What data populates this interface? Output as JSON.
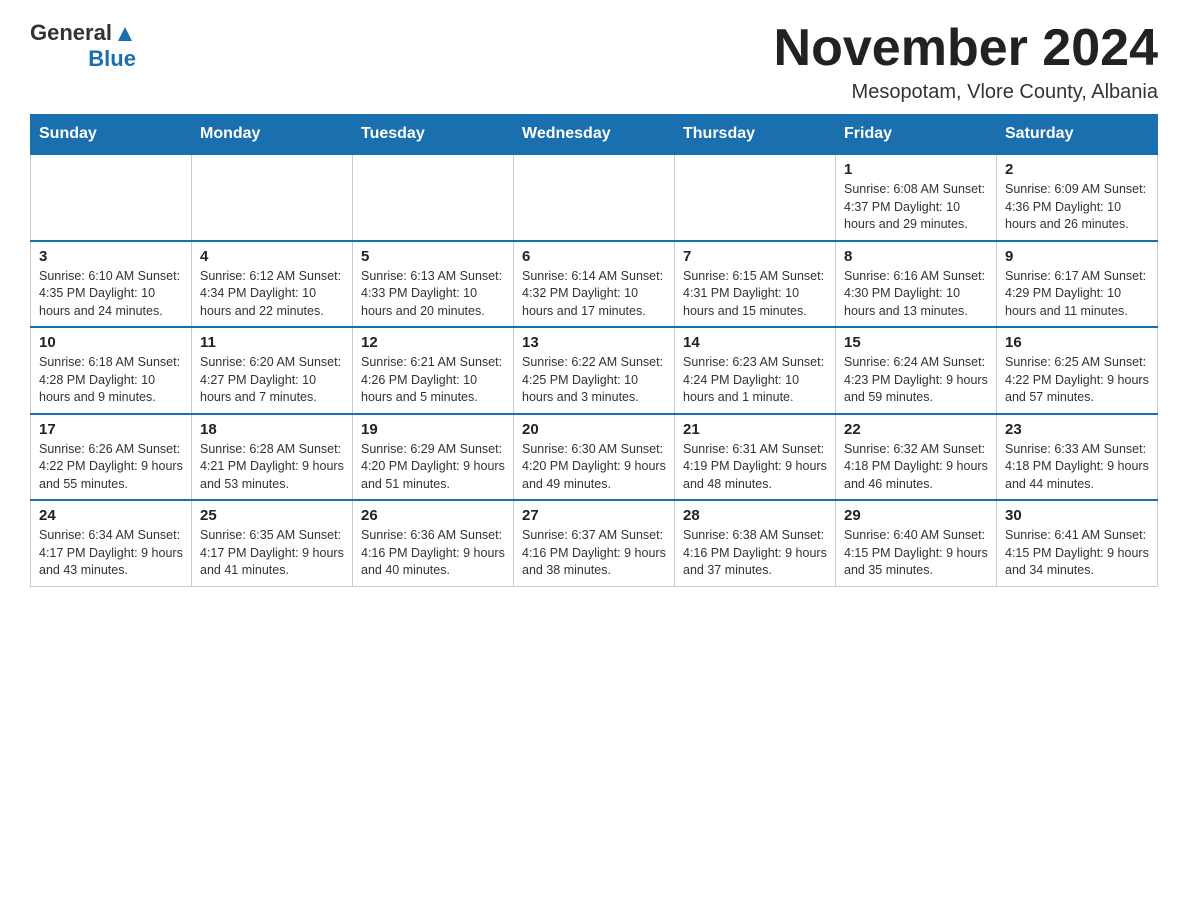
{
  "logo": {
    "general": "General",
    "blue": "Blue"
  },
  "title": "November 2024",
  "subtitle": "Mesopotam, Vlore County, Albania",
  "days_of_week": [
    "Sunday",
    "Monday",
    "Tuesday",
    "Wednesday",
    "Thursday",
    "Friday",
    "Saturday"
  ],
  "weeks": [
    [
      {
        "day": "",
        "info": ""
      },
      {
        "day": "",
        "info": ""
      },
      {
        "day": "",
        "info": ""
      },
      {
        "day": "",
        "info": ""
      },
      {
        "day": "",
        "info": ""
      },
      {
        "day": "1",
        "info": "Sunrise: 6:08 AM\nSunset: 4:37 PM\nDaylight: 10 hours and 29 minutes."
      },
      {
        "day": "2",
        "info": "Sunrise: 6:09 AM\nSunset: 4:36 PM\nDaylight: 10 hours and 26 minutes."
      }
    ],
    [
      {
        "day": "3",
        "info": "Sunrise: 6:10 AM\nSunset: 4:35 PM\nDaylight: 10 hours and 24 minutes."
      },
      {
        "day": "4",
        "info": "Sunrise: 6:12 AM\nSunset: 4:34 PM\nDaylight: 10 hours and 22 minutes."
      },
      {
        "day": "5",
        "info": "Sunrise: 6:13 AM\nSunset: 4:33 PM\nDaylight: 10 hours and 20 minutes."
      },
      {
        "day": "6",
        "info": "Sunrise: 6:14 AM\nSunset: 4:32 PM\nDaylight: 10 hours and 17 minutes."
      },
      {
        "day": "7",
        "info": "Sunrise: 6:15 AM\nSunset: 4:31 PM\nDaylight: 10 hours and 15 minutes."
      },
      {
        "day": "8",
        "info": "Sunrise: 6:16 AM\nSunset: 4:30 PM\nDaylight: 10 hours and 13 minutes."
      },
      {
        "day": "9",
        "info": "Sunrise: 6:17 AM\nSunset: 4:29 PM\nDaylight: 10 hours and 11 minutes."
      }
    ],
    [
      {
        "day": "10",
        "info": "Sunrise: 6:18 AM\nSunset: 4:28 PM\nDaylight: 10 hours and 9 minutes."
      },
      {
        "day": "11",
        "info": "Sunrise: 6:20 AM\nSunset: 4:27 PM\nDaylight: 10 hours and 7 minutes."
      },
      {
        "day": "12",
        "info": "Sunrise: 6:21 AM\nSunset: 4:26 PM\nDaylight: 10 hours and 5 minutes."
      },
      {
        "day": "13",
        "info": "Sunrise: 6:22 AM\nSunset: 4:25 PM\nDaylight: 10 hours and 3 minutes."
      },
      {
        "day": "14",
        "info": "Sunrise: 6:23 AM\nSunset: 4:24 PM\nDaylight: 10 hours and 1 minute."
      },
      {
        "day": "15",
        "info": "Sunrise: 6:24 AM\nSunset: 4:23 PM\nDaylight: 9 hours and 59 minutes."
      },
      {
        "day": "16",
        "info": "Sunrise: 6:25 AM\nSunset: 4:22 PM\nDaylight: 9 hours and 57 minutes."
      }
    ],
    [
      {
        "day": "17",
        "info": "Sunrise: 6:26 AM\nSunset: 4:22 PM\nDaylight: 9 hours and 55 minutes."
      },
      {
        "day": "18",
        "info": "Sunrise: 6:28 AM\nSunset: 4:21 PM\nDaylight: 9 hours and 53 minutes."
      },
      {
        "day": "19",
        "info": "Sunrise: 6:29 AM\nSunset: 4:20 PM\nDaylight: 9 hours and 51 minutes."
      },
      {
        "day": "20",
        "info": "Sunrise: 6:30 AM\nSunset: 4:20 PM\nDaylight: 9 hours and 49 minutes."
      },
      {
        "day": "21",
        "info": "Sunrise: 6:31 AM\nSunset: 4:19 PM\nDaylight: 9 hours and 48 minutes."
      },
      {
        "day": "22",
        "info": "Sunrise: 6:32 AM\nSunset: 4:18 PM\nDaylight: 9 hours and 46 minutes."
      },
      {
        "day": "23",
        "info": "Sunrise: 6:33 AM\nSunset: 4:18 PM\nDaylight: 9 hours and 44 minutes."
      }
    ],
    [
      {
        "day": "24",
        "info": "Sunrise: 6:34 AM\nSunset: 4:17 PM\nDaylight: 9 hours and 43 minutes."
      },
      {
        "day": "25",
        "info": "Sunrise: 6:35 AM\nSunset: 4:17 PM\nDaylight: 9 hours and 41 minutes."
      },
      {
        "day": "26",
        "info": "Sunrise: 6:36 AM\nSunset: 4:16 PM\nDaylight: 9 hours and 40 minutes."
      },
      {
        "day": "27",
        "info": "Sunrise: 6:37 AM\nSunset: 4:16 PM\nDaylight: 9 hours and 38 minutes."
      },
      {
        "day": "28",
        "info": "Sunrise: 6:38 AM\nSunset: 4:16 PM\nDaylight: 9 hours and 37 minutes."
      },
      {
        "day": "29",
        "info": "Sunrise: 6:40 AM\nSunset: 4:15 PM\nDaylight: 9 hours and 35 minutes."
      },
      {
        "day": "30",
        "info": "Sunrise: 6:41 AM\nSunset: 4:15 PM\nDaylight: 9 hours and 34 minutes."
      }
    ]
  ]
}
